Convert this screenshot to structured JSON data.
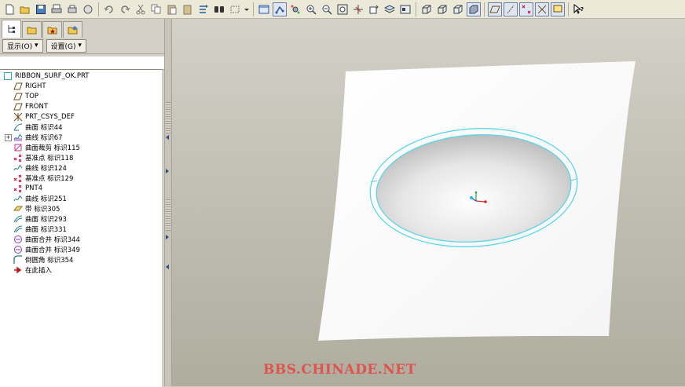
{
  "toolbar": {
    "icons": [
      "new-file-icon",
      "open-folder-icon",
      "save-icon",
      "print-icon",
      "copy-print-icon",
      "mail-icon",
      "undo-icon",
      "redo-icon",
      "cut-icon",
      "copy-icon",
      "paste-icon",
      "paste-special-icon",
      "regenerate-icon",
      "find-icon",
      "select-box-icon",
      "dropdown-icon",
      "repaint-icon",
      "orient-icon",
      "spin-icon",
      "zoom-in-icon",
      "zoom-out-icon",
      "refit-icon",
      "reorient-icon",
      "view-manager-icon",
      "layers-icon",
      "saved-views-icon",
      "wireframe-icon",
      "hidden-line-icon",
      "no-hidden-icon",
      "shading-icon",
      "datum-planes-icon",
      "datum-axes-icon",
      "datum-points-icon",
      "coord-sys-icon",
      "annotations-icon",
      "help-icon"
    ]
  },
  "left_panel": {
    "tabs": [
      "model-tree-tab",
      "folder-browser-tab",
      "favorites-tab",
      "connections-tab"
    ],
    "show_label": "显示(O)",
    "settings_label": "设置(G)",
    "tree": [
      {
        "label": "RIBBON_SURF_OK.PRT",
        "icon": "part-icon"
      },
      {
        "label": "RIGHT",
        "icon": "datum-plane-icon"
      },
      {
        "label": "TOP",
        "icon": "datum-plane-icon"
      },
      {
        "label": "FRONT",
        "icon": "datum-plane-icon"
      },
      {
        "label": "PRT_CSYS_DEF",
        "icon": "coord-sys-icon"
      },
      {
        "label": "曲面 标识44",
        "icon": "surface-icon"
      },
      {
        "label": "曲线 标识67",
        "icon": "curve-icon"
      },
      {
        "label": "曲面裁剪 标识115",
        "icon": "surface-trim-icon"
      },
      {
        "label": "基准点 标识118",
        "icon": "datum-point-icon"
      },
      {
        "label": "曲线 标识124",
        "icon": "curve-icon"
      },
      {
        "label": "基准点 标识129",
        "icon": "datum-point-icon"
      },
      {
        "label": "PNT4",
        "icon": "datum-point-icon"
      },
      {
        "label": "曲线 标识251",
        "icon": "curve-icon"
      },
      {
        "label": "带 标识305",
        "icon": "ribbon-icon"
      },
      {
        "label": "曲面 标识293",
        "icon": "surface-icon"
      },
      {
        "label": "曲面 标识331",
        "icon": "surface-icon"
      },
      {
        "label": "曲面合并 标识344",
        "icon": "merge-icon"
      },
      {
        "label": "曲面合并 标识349",
        "icon": "merge-icon"
      },
      {
        "label": "倒圆角 标识354",
        "icon": "round-icon"
      },
      {
        "label": "在此插入",
        "icon": "insert-here-icon"
      }
    ]
  },
  "viewport": {
    "watermark": "BBS.CHINADE.NET"
  },
  "colors": {
    "edge_highlight": "#5ad6e8",
    "watermark": "#e0524e",
    "insert_arrow": "#c0181c"
  }
}
